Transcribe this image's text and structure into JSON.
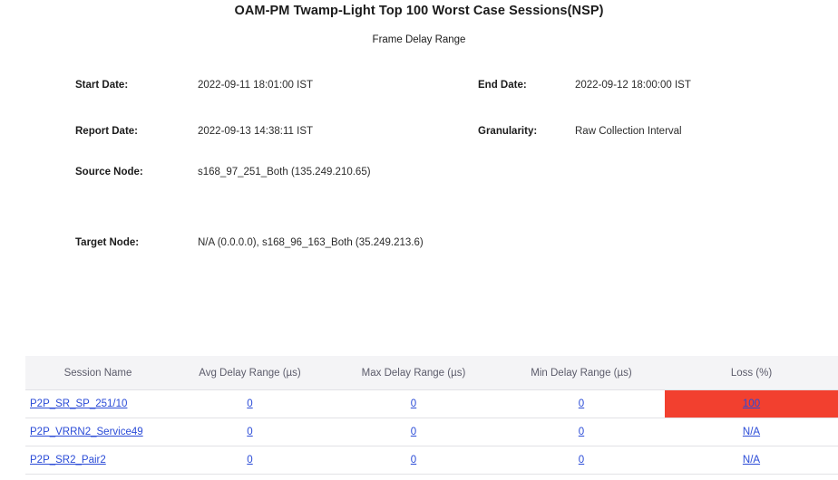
{
  "report": {
    "title": "OAM-PM Twamp-Light Top 100 Worst Case Sessions(NSP)",
    "subtitle": "Frame Delay Range"
  },
  "meta": {
    "start_date_label": "Start Date:",
    "start_date_value": "2022-09-11 18:01:00 IST",
    "report_date_label": "Report Date:",
    "report_date_value": "2022-09-13 14:38:11 IST",
    "source_node_label": "Source Node:",
    "source_node_value": "s168_97_251_Both (135.249.210.65)",
    "target_node_label": "Target Node:",
    "target_node_value": "N/A (0.0.0.0), s168_96_163_Both (35.249.213.6)",
    "end_date_label": "End Date:",
    "end_date_value": "2022-09-12 18:00:00 IST",
    "granularity_label": "Granularity:",
    "granularity_value": "Raw Collection Interval"
  },
  "table": {
    "columns": [
      "Session Name",
      "Avg Delay Range (µs)",
      "Max Delay Range (µs)",
      "Min Delay Range (µs)",
      "Loss (%)"
    ],
    "rows": [
      {
        "session_name": "P2P_SR_SP_251/10",
        "avg_delay_range": "0",
        "max_delay_range": "0",
        "min_delay_range": "0",
        "loss_pct": "100",
        "loss_alert": true
      },
      {
        "session_name": "P2P_VRRN2_Service49",
        "avg_delay_range": "0",
        "max_delay_range": "0",
        "min_delay_range": "0",
        "loss_pct": "N/A",
        "loss_alert": false
      },
      {
        "session_name": "P2P_SR2_Pair2",
        "avg_delay_range": "0",
        "max_delay_range": "0",
        "min_delay_range": "0",
        "loss_pct": "N/A",
        "loss_alert": false
      }
    ]
  },
  "colors": {
    "alert_background": "#f2402f",
    "link": "#2a4bd7",
    "header_background": "#f4f4f6",
    "header_text": "#5c5c6b"
  }
}
